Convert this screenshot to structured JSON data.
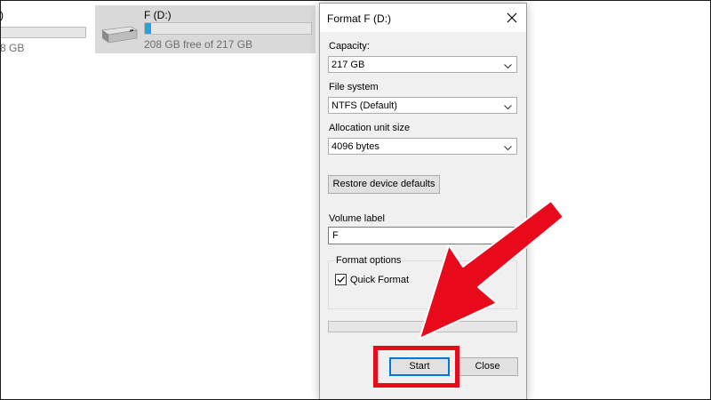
{
  "explorer": {
    "partial_drive": {
      "name": ")",
      "free_text": "8 GB"
    },
    "drive_f": {
      "name": "F (D:)",
      "free_text": "208 GB free of 217 GB",
      "used_fraction": 0.04,
      "bar_color": "#26a0da"
    }
  },
  "dialog": {
    "title": "Format F (D:)",
    "close_icon": "close-icon",
    "capacity": {
      "label": "Capacity:",
      "value": "217 GB"
    },
    "file_system": {
      "label": "File system",
      "value": "NTFS (Default)"
    },
    "allocation": {
      "label": "Allocation unit size",
      "value": "4096 bytes"
    },
    "restore_button": "Restore device defaults",
    "volume": {
      "label": "Volume label",
      "value": "F"
    },
    "format_options": {
      "legend": "Format options",
      "quick_format_label": "Quick Format",
      "quick_format_checked": true
    },
    "progress": 0,
    "start_button": "Start",
    "close_button": "Close"
  },
  "annotation": {
    "color": "#e8091a",
    "arrow_icon": "arrow-icon"
  }
}
